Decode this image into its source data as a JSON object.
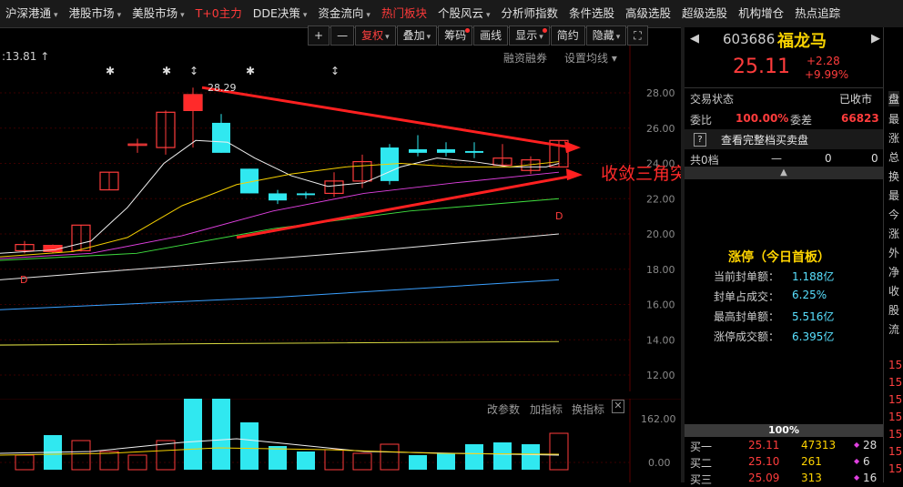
{
  "menu": {
    "items": [
      {
        "label": "沪深港通",
        "dd": true
      },
      {
        "label": "港股市场",
        "dd": true
      },
      {
        "label": "美股市场",
        "dd": true
      },
      {
        "label": "T+0主力",
        "dd": false,
        "red": true
      },
      {
        "label": "DDE决策",
        "dd": true
      },
      {
        "label": "资金流向",
        "dd": true
      },
      {
        "label": "热门板块",
        "dd": false,
        "hot": true
      },
      {
        "label": "个股风云",
        "dd": true
      },
      {
        "label": "分析师指数",
        "dd": false
      },
      {
        "label": "条件选股",
        "dd": false
      },
      {
        "label": "高级选股",
        "dd": false
      },
      {
        "label": "超级选股",
        "dd": false
      },
      {
        "label": "机构增仓",
        "dd": false
      },
      {
        "label": "热点追踪",
        "dd": false
      }
    ]
  },
  "toolbar": {
    "plus": "+",
    "minus": "—",
    "fuquan": "复权",
    "diejia": "叠加",
    "chouma": "筹码",
    "huaxian": "画线",
    "xianshi": "显示",
    "jianyue": "简约",
    "yincang": "隐藏",
    "expand": "⛶"
  },
  "chart": {
    "price_readout": ":13.81",
    "rzrq": "融资融券",
    "sz_junxian": "设置均线",
    "high_label": "28.29",
    "annotation": "收敛三角突破",
    "marker_d": "D",
    "y_ticks": [
      "28.00",
      "26.00",
      "24.00",
      "22.00",
      "20.00",
      "18.00",
      "16.00",
      "14.00",
      "12.00"
    ]
  },
  "volume": {
    "gai_canshu": "改参数",
    "jia_zhibiao": "加指标",
    "huan_zhibiao": "换指标",
    "y_ticks": [
      "162.00",
      "0.00"
    ]
  },
  "quote": {
    "code": "603686",
    "name": "福龙马",
    "price": "25.11",
    "change": "+2.28",
    "pct": "+9.99%",
    "status_label": "交易状态",
    "status_value": "已收市",
    "weibi_label": "委比",
    "weibi_value": "100.00%",
    "weicha_label": "委差",
    "weicha_value": "66823",
    "full_book": "查看完整档买卖盘",
    "question": "?",
    "gong0dang": "共0档",
    "dash": "—",
    "z1": "0",
    "z2": "0",
    "zhangting_title": "涨停（今日首板）",
    "stats": [
      {
        "label": "当前封单额：",
        "value": "1.188亿"
      },
      {
        "label": "封单占成交：",
        "value": "6.25%"
      },
      {
        "label": "最高封单额：",
        "value": "5.516亿"
      },
      {
        "label": "涨停成交额：",
        "value": "6.395亿"
      }
    ],
    "pct_bar": "100%",
    "bids": [
      {
        "label": "买一",
        "price": "25.11",
        "vol": "47313",
        "n": "28"
      },
      {
        "label": "买二",
        "price": "25.10",
        "vol": "261",
        "n": "6"
      },
      {
        "label": "买三",
        "price": "25.09",
        "vol": "313",
        "n": "16"
      }
    ],
    "side_tab": "盘",
    "side_chars": [
      "最",
      "涨",
      "总",
      "换",
      "最",
      "今",
      "涨",
      "外",
      "净",
      "收",
      "股",
      "流"
    ],
    "side_nums": [
      "15",
      "15",
      "15",
      "15",
      "15",
      "15",
      "15"
    ]
  }
}
